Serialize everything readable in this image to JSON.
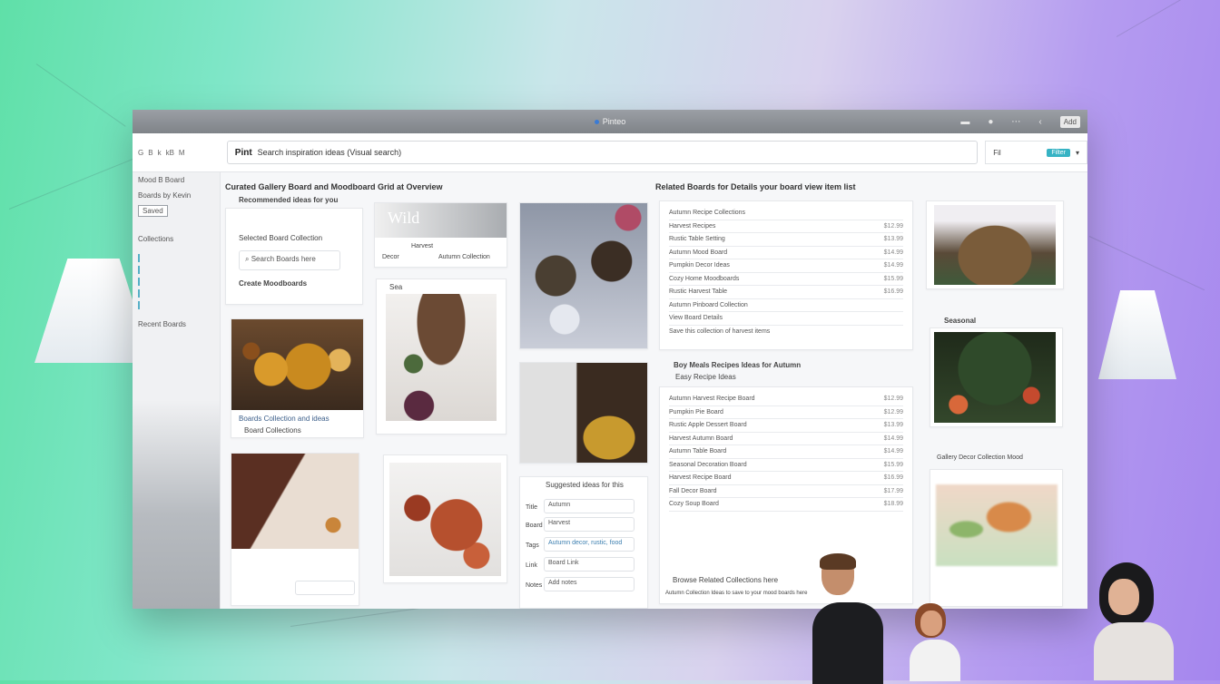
{
  "window": {
    "title": "Pinteo",
    "toolbar_badge": "Add"
  },
  "toolbar": {
    "nav_items": [
      "G",
      "B",
      "k",
      "kB",
      "M"
    ],
    "search_logo": "Pint",
    "search_text": "Search inspiration ideas (Visual search)",
    "right_label": "Fil",
    "right_badge": "Filter",
    "right_chevron": "▾"
  },
  "sidebar": {
    "top_item": "Mood B  Board",
    "items": [
      "Boards by Kevin",
      "Recent Boards"
    ],
    "chip": "Saved",
    "section": "Collections"
  },
  "left_column": {
    "heading": "Curated Gallery Board and Moodboard Grid at Overview",
    "sub_heading": "Recommended ideas for you",
    "item_one": "Selected Board Collection",
    "input_text": "Search Boards here",
    "item_two": "Create Moodboards",
    "pumpkin_caption": "Boards Collection and ideas",
    "pumpkin_caption_2": "Board Collections",
    "banner_title": "Wild",
    "banner_lines": [
      "Harvest",
      "Decor",
      "Autumn Collection"
    ],
    "photo_caption": "Sea",
    "form_title": "Suggested ideas for this",
    "form_fields": [
      {
        "label": "Title",
        "value": "Autumn"
      },
      {
        "label": "Board",
        "value": "Harvest"
      },
      {
        "label": "Tags",
        "value": "Autumn decor, rustic, food"
      },
      {
        "label": "Link",
        "value": "Board Link"
      },
      {
        "label": "Notes",
        "value": "Add notes"
      }
    ]
  },
  "right_column": {
    "heading": "Related Boards for Details your board view item list",
    "list_top": [
      {
        "label": "Autumn Recipe Collections",
        "value": ""
      },
      {
        "label": "Harvest Recipes",
        "value": "$12.99"
      },
      {
        "label": "Rustic Table Setting",
        "value": "$13.99"
      },
      {
        "label": "Autumn Mood Board",
        "value": "$14.99"
      },
      {
        "label": "Pumpkin Decor Ideas",
        "value": "$14.99"
      },
      {
        "label": "Cozy Home Moodboards",
        "value": "$15.99"
      },
      {
        "label": "Rustic Harvest Table",
        "value": "$16.99"
      }
    ],
    "list_top_footer": "Autumn Pinboard Collection",
    "list_top_footer_2": "View Board Details",
    "list_top_note": "Save this collection of harvest items",
    "mid_heading": "Boy Meals Recipes Ideas for Autumn",
    "mid_heading_2": "Easy Recipe Ideas",
    "list_bottom": [
      {
        "label": "Autumn Harvest Recipe Board",
        "value": "$12.99"
      },
      {
        "label": "Pumpkin Pie Board",
        "value": "$12.99"
      },
      {
        "label": "Rustic Apple Dessert Board",
        "value": "$13.99"
      },
      {
        "label": "Harvest Autumn Board",
        "value": "$14.99"
      },
      {
        "label": "Autumn Table Board",
        "value": "$14.99"
      },
      {
        "label": "Seasonal Decoration Board",
        "value": "$15.99"
      },
      {
        "label": "Harvest Recipe Board",
        "value": "$16.99"
      },
      {
        "label": "Fall Decor Board",
        "value": "$17.99"
      },
      {
        "label": "Cozy Soup Board",
        "value": "$18.99"
      }
    ],
    "bottom_note": "Browse Related Collections here",
    "bottom_note_2": "Autumn Collection Ideas to save to your mood boards here",
    "side_caption_1": "Seasonal",
    "side_caption_2": "Gallery Decor Collection Mood"
  },
  "colors": {
    "accent": "#37b3c4",
    "link": "#3c5f8a"
  }
}
